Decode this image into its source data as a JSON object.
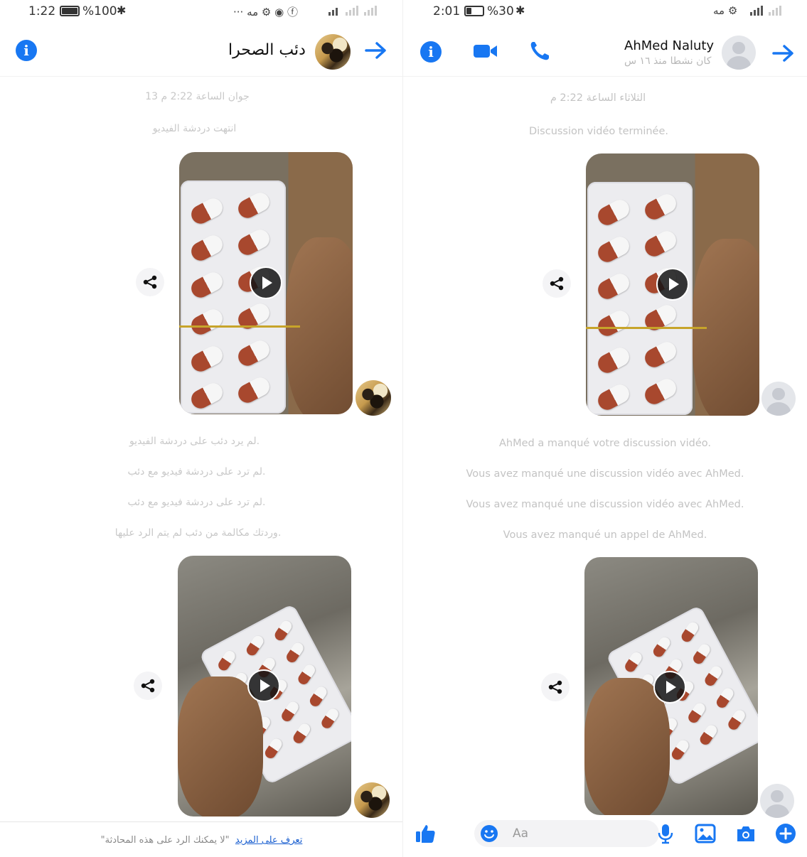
{
  "colors": {
    "accent": "#1877f2",
    "system_text": "#c8c8c8",
    "link": "#1a5fd0"
  },
  "left": {
    "status": {
      "time": "1:22",
      "battery_pct": "%100",
      "battery_level": 1.0,
      "icons": "··· مه ⚙ ◉ ⓕ"
    },
    "header": {
      "title": "دئب الصحرا",
      "info_icon": "i"
    },
    "messages": {
      "date": "13 جوان الساعة 2:22 م",
      "video_chat_ended": "انتهت دردشة الفيديو",
      "missed_1": "لم يرد دئب على دردشة الفيديو.",
      "missed_2": "لم ترد على دردشة فيديو مع دئب.",
      "missed_3": "لم ترد على دردشة فيديو مع دئب.",
      "missed_4": "وردتك مكالمة من دئب لم يتم الرد عليها."
    },
    "footer": {
      "text": "\"لا يمكنك الرد على هذه المحادثة",
      "link": "تعرف على المزيد",
      "end_quote": "\""
    }
  },
  "right": {
    "status": {
      "time": "2:01",
      "battery_pct": "%30",
      "battery_level": 0.3,
      "icons": "مه ⚙"
    },
    "header": {
      "title": "AhMed Naluty",
      "subtitle": "كان نشطا منذ ١٦ س",
      "info_icon": "i"
    },
    "messages": {
      "date": "الثلاثاء الساعة 2:22 م",
      "video_chat_ended": "Discussion vidéo terminée.",
      "missed_1": "AhMed a manqué votre discussion vidéo.",
      "missed_2": "Vous avez manqué une discussion vidéo avec AhMed.",
      "missed_3": "Vous avez manqué une discussion vidéo avec AhMed.",
      "missed_4": "Vous avez manqué un appel de AhMed."
    },
    "composer": {
      "placeholder": "Aa"
    }
  }
}
